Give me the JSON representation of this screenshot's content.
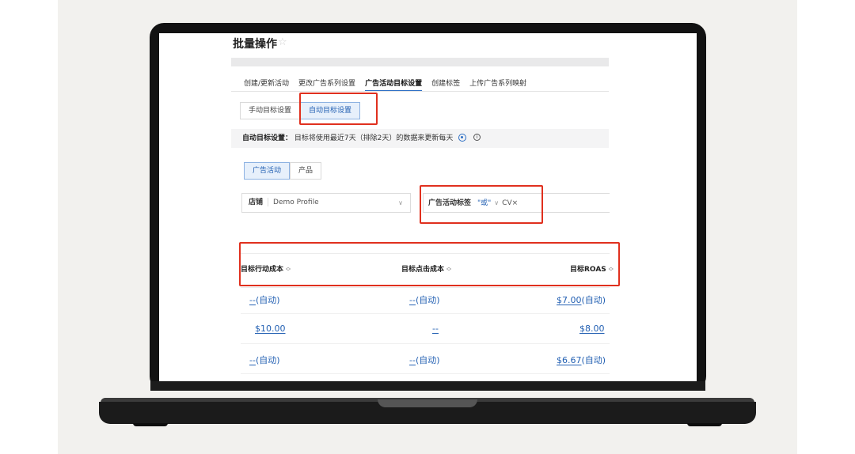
{
  "page": {
    "title": "批量操作",
    "star_icon": "star-outline-icon"
  },
  "tabs": [
    {
      "label": "创建/更新活动",
      "active": false
    },
    {
      "label": "更改广告系列设置",
      "active": false
    },
    {
      "label": "广告活动目标设置",
      "active": true
    },
    {
      "label": "创建标签",
      "active": false
    },
    {
      "label": "上传广告系列映射",
      "active": false
    }
  ],
  "mode_toggle": {
    "manual": "手动目标设置",
    "auto": "自动目标设置",
    "selected": "auto"
  },
  "info": {
    "label": "自动目标设置：",
    "text": "目标将使用最近7天（排除2天）的数据来更新每天",
    "settings_icon": "gear-icon",
    "help_icon": "info-icon"
  },
  "level_toggle": {
    "campaign": "广告活动",
    "product": "产品",
    "selected": "campaign"
  },
  "filters": {
    "store_label": "店铺",
    "store_value": "Demo Profile",
    "tag_label": "广告活动标签",
    "tag_operator": "\"或\"",
    "tag_chip": "CV",
    "tag_chip_remove": "×"
  },
  "table": {
    "columns": [
      "目标行动成本",
      "目标点击成本",
      "目标ROAS"
    ],
    "rows": [
      {
        "cpa": "--",
        "cpa_suffix": "(自动)",
        "cpc": "--",
        "cpc_suffix": "(自动)",
        "roas": "$7.00",
        "roas_suffix": "(自动)"
      },
      {
        "cpa": "$10.00",
        "cpa_suffix": "",
        "cpc": "--",
        "cpc_suffix": "",
        "roas": "$8.00",
        "roas_suffix": ""
      },
      {
        "cpa": "--",
        "cpa_suffix": "(自动)",
        "cpc": "--",
        "cpc_suffix": "(自动)",
        "roas": "$6.67",
        "roas_suffix": "(自动)"
      }
    ]
  },
  "colors": {
    "accent": "#2461b3",
    "highlight": "#e0301e",
    "background": "#f2f1ee"
  }
}
